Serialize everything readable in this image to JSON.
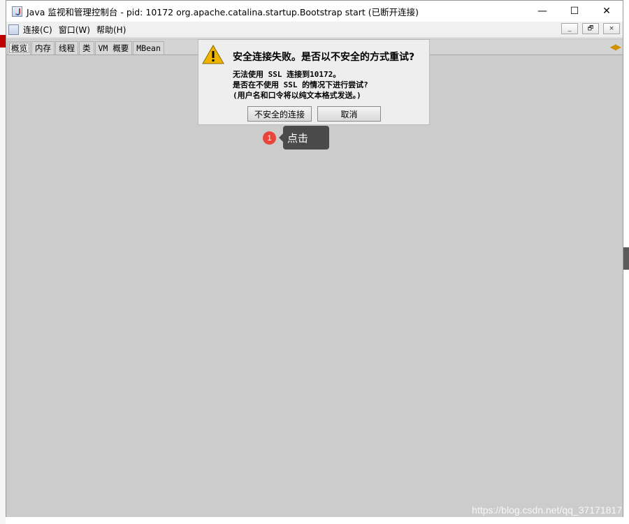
{
  "window": {
    "title": "Java 监视和管理控制台 - pid: 10172 org.apache.catalina.startup.Bootstrap start (已断开连接)",
    "controls": {
      "minimize": "—",
      "maximize": "☐",
      "close": "✕"
    }
  },
  "menubar": {
    "items": [
      "连接(C)",
      "窗口(W)",
      "帮助(H)"
    ],
    "mdi_controls": {
      "minimize": "_",
      "restore": "🗗",
      "close": "×"
    }
  },
  "tabs": {
    "items": [
      "概览",
      "内存",
      "线程",
      "类",
      "VM 概要",
      "MBean"
    ],
    "active": "概览"
  },
  "dialog": {
    "icon": "warning-icon",
    "title": "安全连接失败。是否以不安全的方式重试?",
    "message_lines": [
      "无法使用 SSL 连接到10172。",
      "是否在不使用 SSL 的情况下进行尝试?",
      "(用户名和口令将以纯文本格式发送。)"
    ],
    "buttons": {
      "insecure": "不安全的连接",
      "cancel": "取消"
    }
  },
  "annotation": {
    "step": "1",
    "text": "点击"
  },
  "watermark": "https://blog.csdn.net/qq_37171817",
  "colors": {
    "accent_warning": "#f0b400",
    "badge": "#e8453c",
    "tooltip_bg": "#4a4a4a",
    "content_bg": "#cccccc"
  }
}
